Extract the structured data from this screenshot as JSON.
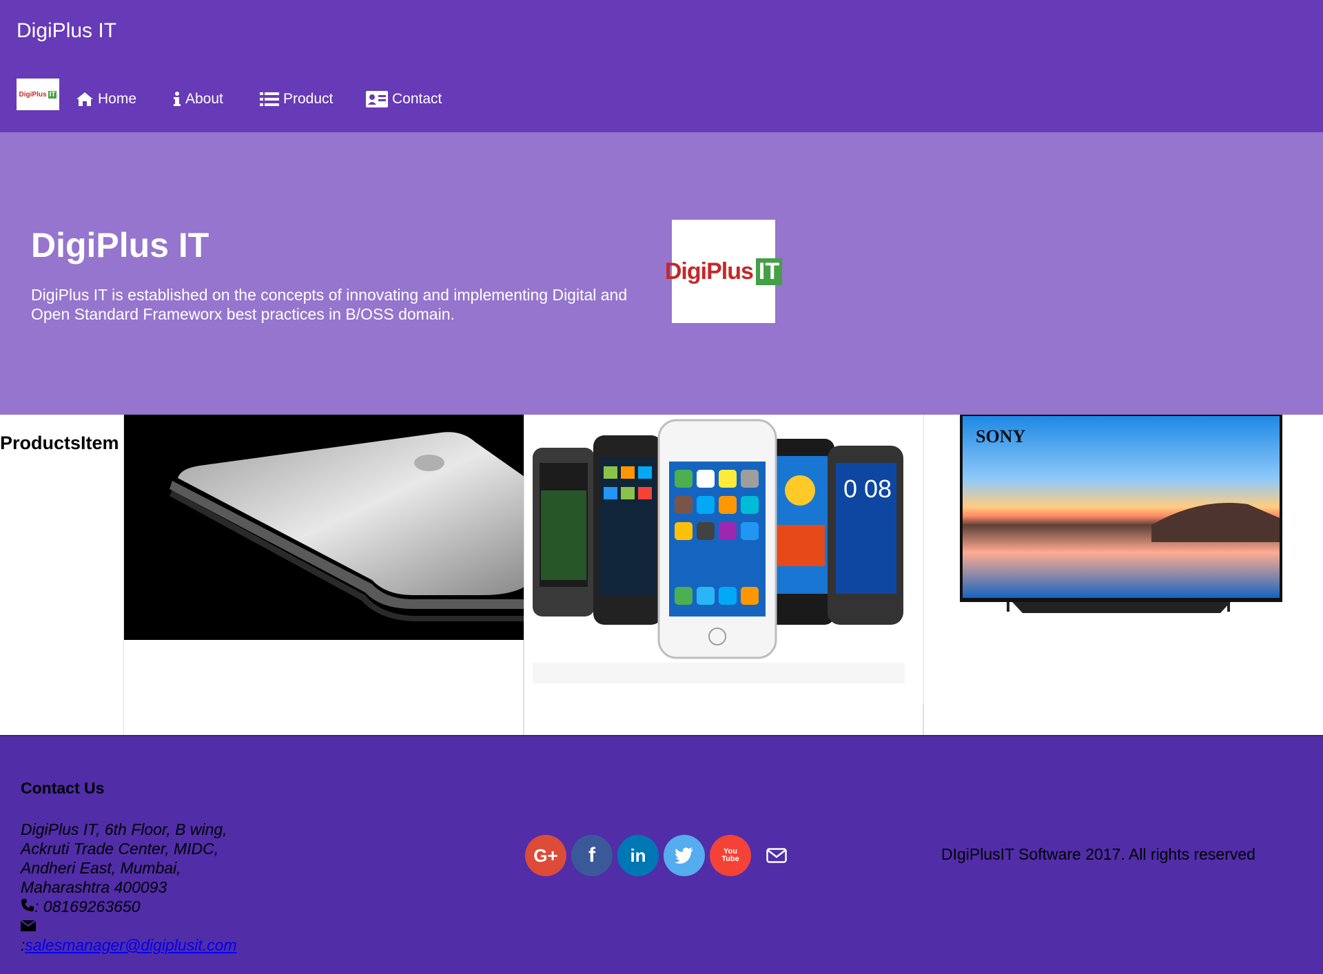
{
  "header": {
    "brand": "DigiPlus IT",
    "logo": {
      "main": "DigiPlus",
      "badge": "IT"
    }
  },
  "nav": {
    "items": [
      {
        "label": "Home",
        "icon": "home-icon"
      },
      {
        "label": "About",
        "icon": "info-icon"
      },
      {
        "label": "Product",
        "icon": "list-icon"
      },
      {
        "label": "Contact",
        "icon": "contact-card-icon"
      }
    ]
  },
  "hero": {
    "title": "DigiPlus IT",
    "description": "DigiPlus IT is established on the concepts of innovating and implementing Digital and Open Standard Frameworx best practices in B/OSS domain.",
    "logo": {
      "main": "DigiPlus",
      "badge": "IT"
    }
  },
  "products": {
    "heading": "ProductsItem",
    "items": [
      {
        "image": "laptop-image"
      },
      {
        "image": "smartphones-image"
      },
      {
        "image": "tv-image",
        "brand": "SONY",
        "clock": "0 08"
      }
    ]
  },
  "footer": {
    "contact_title": "Contact Us",
    "address_lines": [
      "DigiPlus IT, 6th Floor, B wing,",
      "Ackruti Trade Center, MIDC,",
      "Andheri East, Mumbai,",
      "Maharashtra 400093"
    ],
    "phone": ": 08169263650",
    "email_prefix": ":",
    "email": "salesmanager@digiplusit.com",
    "social": [
      {
        "name": "google-plus",
        "color": "#dd4b39",
        "glyph": "G+"
      },
      {
        "name": "facebook",
        "color": "#3b5998",
        "glyph": "f"
      },
      {
        "name": "linkedin",
        "color": "#0077b5",
        "glyph": "in"
      },
      {
        "name": "twitter",
        "color": "#55acee",
        "glyph": "t"
      },
      {
        "name": "youtube",
        "color": "#f44336",
        "glyph": "You Tube"
      }
    ],
    "copyright": "DIgiPlusIT Software 2017. All rights reserved"
  },
  "colors": {
    "navbar": "#673ab7",
    "hero": "#9575cd",
    "footer": "#512da8"
  }
}
